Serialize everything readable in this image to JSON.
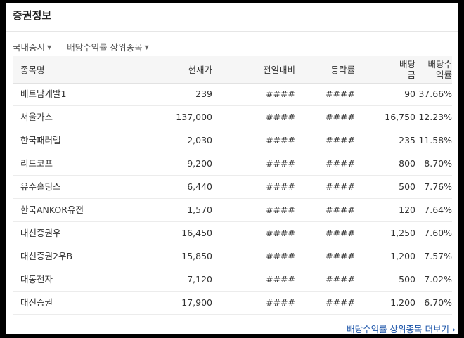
{
  "panel": {
    "title": "증권정보",
    "filters": [
      {
        "label": "국내증시",
        "caret": "▼"
      },
      {
        "label": "배당수익률 상위종목",
        "caret": "▼"
      }
    ],
    "headers": {
      "name": "종목명",
      "price": "현재가",
      "change": "전일대비",
      "rate": "등락률",
      "dividend_line1": "배당",
      "dividend_line2": "금",
      "yield_line1": "배당수",
      "yield_line2": "익률"
    },
    "rows": [
      {
        "name": "베트남개발1",
        "price": "239",
        "change": "####",
        "rate": "####",
        "dividend": "90",
        "yield": "37.66%"
      },
      {
        "name": "서울가스",
        "price": "137,000",
        "change": "####",
        "rate": "####",
        "dividend": "16,750",
        "yield": "12.23%"
      },
      {
        "name": "한국패러렐",
        "price": "2,030",
        "change": "####",
        "rate": "####",
        "dividend": "235",
        "yield": "11.58%"
      },
      {
        "name": "리드코프",
        "price": "9,200",
        "change": "####",
        "rate": "####",
        "dividend": "800",
        "yield": "8.70%"
      },
      {
        "name": "유수홀딩스",
        "price": "6,440",
        "change": "####",
        "rate": "####",
        "dividend": "500",
        "yield": "7.76%"
      },
      {
        "name": "한국ANKOR유전",
        "price": "1,570",
        "change": "####",
        "rate": "####",
        "dividend": "120",
        "yield": "7.64%"
      },
      {
        "name": "대신증권우",
        "price": "16,450",
        "change": "####",
        "rate": "####",
        "dividend": "1,250",
        "yield": "7.60%"
      },
      {
        "name": "대신증권2우B",
        "price": "15,850",
        "change": "####",
        "rate": "####",
        "dividend": "1,200",
        "yield": "7.57%"
      },
      {
        "name": "대동전자",
        "price": "7,120",
        "change": "####",
        "rate": "####",
        "dividend": "500",
        "yield": "7.02%"
      },
      {
        "name": "대신증권",
        "price": "17,900",
        "change": "####",
        "rate": "####",
        "dividend": "1,200",
        "yield": "6.70%"
      }
    ],
    "more_link": "배당수익률 상위종목 더보기",
    "more_icon": "›"
  }
}
